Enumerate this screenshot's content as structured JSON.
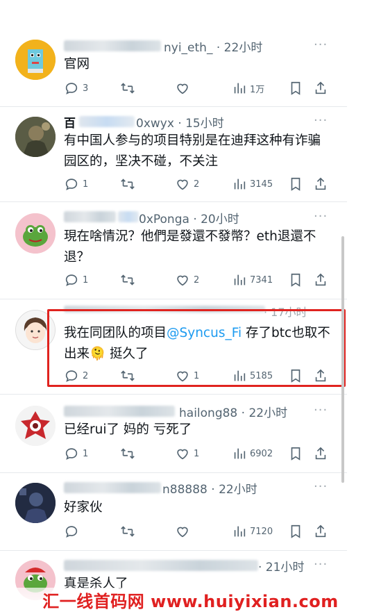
{
  "tweets": [
    {
      "name_visible": "nyi_eth_",
      "time": "· 22小时",
      "more": "···",
      "body": "官网",
      "stats": {
        "reply": "3",
        "retweet": "",
        "like": "",
        "views": "1万"
      }
    },
    {
      "name_prefix": "百",
      "name_visible": "0xwyx",
      "time": "· 15小时",
      "more": "···",
      "body": "有中国人参与的项目特别是在迪拜这种有诈骗园区的，坚决不碰，不关注",
      "stats": {
        "reply": "1",
        "retweet": "",
        "like": "2",
        "views": "3145"
      }
    },
    {
      "name_visible": "0xPonga",
      "time": "· 20小时",
      "more": "···",
      "body": "現在啥情況？他們是發還不發幣？eth退還不退？",
      "stats": {
        "reply": "1",
        "retweet": "",
        "like": "2",
        "views": "7341"
      }
    },
    {
      "time": "· 17小时",
      "body_before": "我在同团队的项目",
      "mention": "@Syncus_Fi",
      "body_after": " 存了btc也取不出来",
      "emoji": "🫠",
      "body_end": " 挺久了",
      "stats": {
        "reply": "2",
        "retweet": "",
        "like": "1",
        "views": "5185"
      }
    },
    {
      "name_visible": "hailong88",
      "time": "· 22小时",
      "more": "···",
      "body": "已经rui了 妈的 亏死了",
      "stats": {
        "reply": "1",
        "retweet": "",
        "like": "1",
        "views": "6902"
      }
    },
    {
      "name_visible": "n88888",
      "time": "· 22小时",
      "more": "···",
      "body": "好家伙",
      "stats": {
        "reply": "",
        "retweet": "",
        "like": "",
        "views": "7120"
      }
    },
    {
      "time": "· 21小时",
      "more": "···",
      "body": "真是杀人了"
    }
  ],
  "watermark": "汇一线首码网  www.huiyixian.com",
  "colors": {
    "accent": "#1d9bf0",
    "highlight": "#e0231f",
    "watermark": "#e02020"
  }
}
